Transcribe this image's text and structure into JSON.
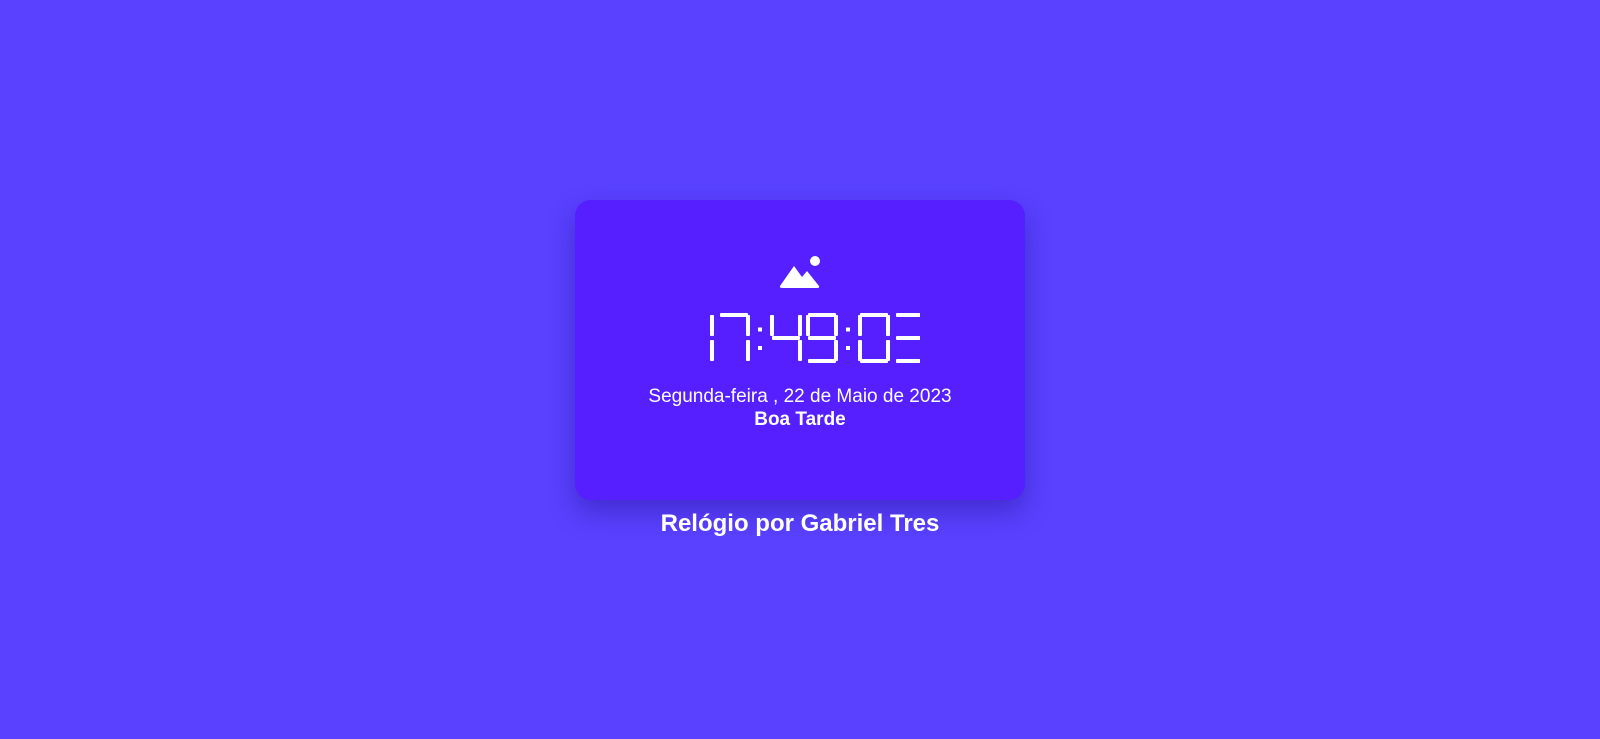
{
  "clock": {
    "time": "17:49:03",
    "date": "Segunda-feira , 22 de Maio de 2023",
    "greeting": "Boa Tarde",
    "period_icon": "mountain-icon"
  },
  "footer": {
    "credit": "Relógio por Gabriel Tres"
  },
  "colors": {
    "background": "#5941ff",
    "card": "#551fff",
    "text": "#ffffff"
  }
}
